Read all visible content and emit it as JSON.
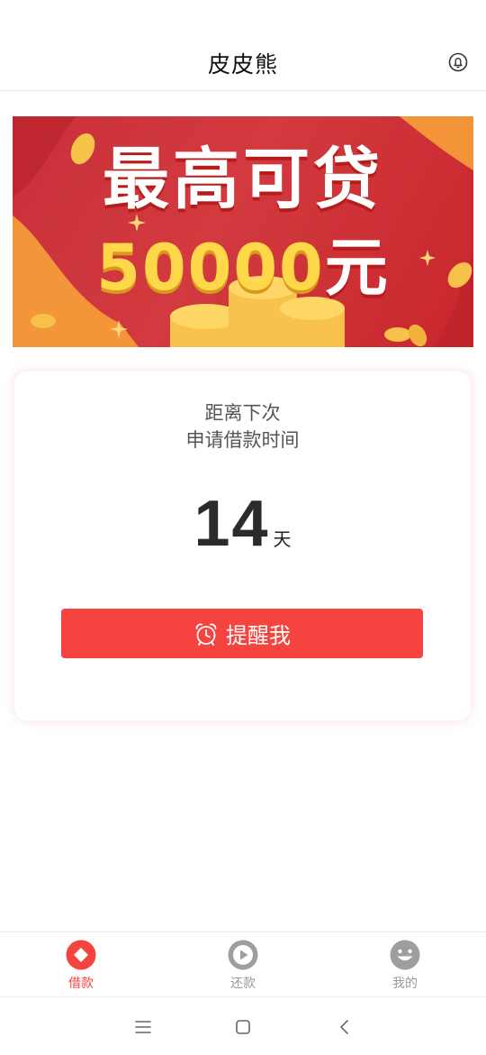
{
  "header": {
    "title": "皮皮熊",
    "right_icon": "bell-icon"
  },
  "banner": {
    "line1": "最高可贷",
    "amount": "50000",
    "unit": "元"
  },
  "card": {
    "line1": "距离下次",
    "line2": "申请借款时间",
    "days_value": "14",
    "days_unit": "天",
    "remind_button": "提醒我",
    "remind_icon": "alarm-clock-icon"
  },
  "tabbar": {
    "items": [
      {
        "label": "借款",
        "icon": "diamond-icon",
        "active": true
      },
      {
        "label": "还款",
        "icon": "play-icon",
        "active": false
      },
      {
        "label": "我的",
        "icon": "smile-icon",
        "active": false
      }
    ]
  },
  "system_nav": {
    "icons": [
      "menu-icon",
      "home-square-icon",
      "back-chevron-icon"
    ]
  },
  "colors": {
    "accent": "#f5433f",
    "banner_red": "#c9303a",
    "banner_gold": "#ffd84a",
    "inactive_icon": "#9e9e9e"
  }
}
